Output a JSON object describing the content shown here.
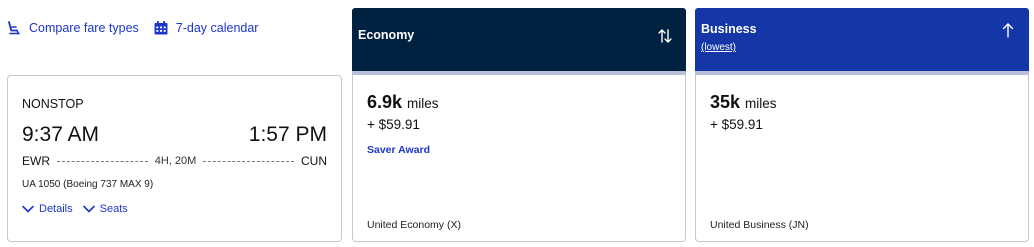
{
  "toolbar": {
    "compare_label": "Compare fare types",
    "compare_icon": "seat-icon",
    "calendar_label": "7-day calendar",
    "calendar_icon": "calendar-icon"
  },
  "flight": {
    "stops": "NONSTOP",
    "departure_time": "9:37 AM",
    "arrival_time": "1:57 PM",
    "origin": "EWR",
    "destination": "CUN",
    "duration": "4H, 20M",
    "equipment": "UA 1050 (Boeing 737 MAX 9)",
    "details_label": "Details",
    "seats_label": "Seats"
  },
  "columns": {
    "economy": {
      "title": "Economy",
      "sort_icon": "sort-arrows-icon"
    },
    "business": {
      "title": "Business",
      "subtitle": "(lowest)",
      "sort_icon": "arrow-up-icon"
    }
  },
  "fares": {
    "economy": {
      "miles": "6.9k",
      "miles_unit": "miles",
      "taxes": "+ $59.91",
      "award_type": "Saver Award",
      "fare_class": "United Economy (X)"
    },
    "business": {
      "miles": "35k",
      "miles_unit": "miles",
      "taxes": "+ $59.91",
      "fare_class": "United Business (JN)"
    }
  },
  "colors": {
    "link": "#1c36c9",
    "economy_header": "#00213f",
    "business_header": "#1436a6"
  }
}
